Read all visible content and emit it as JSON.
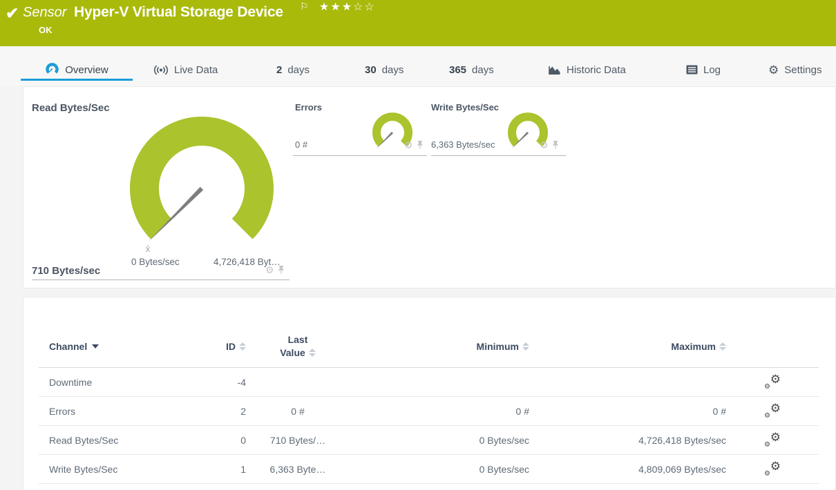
{
  "header": {
    "check": "✔",
    "kind_label": "Sensor",
    "title": "Hyper-V Virtual Storage Device",
    "flag": "⚐",
    "stars": "★★★☆☆",
    "status": "OK"
  },
  "tabs": {
    "overview": "Overview",
    "live_data": "Live Data",
    "d2_num": "2",
    "d2_unit": "days",
    "d30_num": "30",
    "d30_unit": "days",
    "d365_num": "365",
    "d365_unit": "days",
    "historic": "Historic Data",
    "log": "Log",
    "settings": "Settings",
    "settings_gear": "⚙"
  },
  "gauges": {
    "primary": {
      "name": "Read Bytes/Sec",
      "value": "710 Bytes/sec",
      "min_label": "0 Bytes/sec",
      "max_label": "4,726,418 Byt…",
      "avg_marker": "x̄"
    },
    "errors": {
      "name": "Errors",
      "value": "0 #"
    },
    "write": {
      "name": "Write Bytes/Sec",
      "value": "6,363 Bytes/sec"
    },
    "tool_gear": "⚙"
  },
  "table": {
    "headers": {
      "channel": "Channel",
      "id": "ID",
      "last1": "Last",
      "last2": "Value",
      "minimum": "Minimum",
      "maximum": "Maximum"
    },
    "gear_glyph": "⚙",
    "rows": [
      {
        "channel": "Downtime",
        "id": "-4",
        "last": "",
        "min": "",
        "max": ""
      },
      {
        "channel": "Errors",
        "id": "2",
        "last": "0 #",
        "min": "0 #",
        "max": "0 #"
      },
      {
        "channel": "Read Bytes/Sec",
        "id": "0",
        "last": "710 Bytes/…",
        "min": "0 Bytes/sec",
        "max": "4,726,418 Bytes/sec"
      },
      {
        "channel": "Write Bytes/Sec",
        "id": "1",
        "last": "6,363 Byte…",
        "min": "0 Bytes/sec",
        "max": "4,809,069 Bytes/sec"
      }
    ]
  },
  "colors": {
    "status_bar_bg": "#a9ba0b",
    "gauge_green": "#abc32d",
    "needle_gray": "#7e7e7e",
    "accent_blue": "#1b9dd9"
  }
}
